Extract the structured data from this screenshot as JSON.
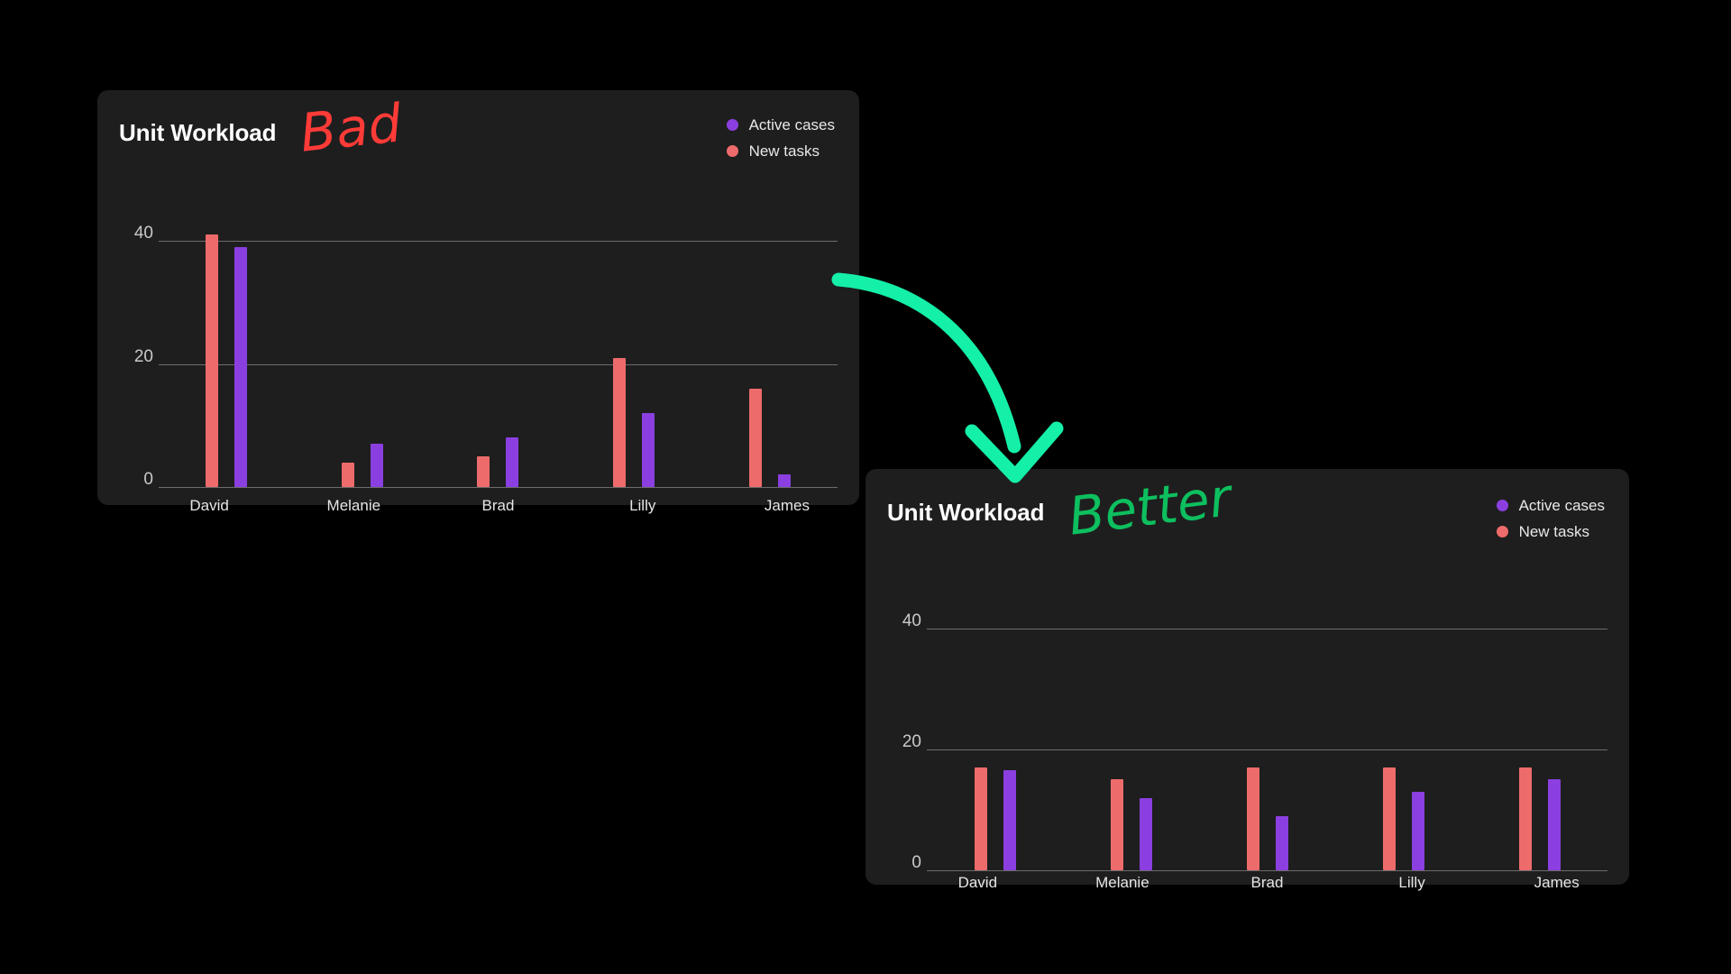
{
  "background_color": "#000000",
  "card_color": "#1e1e1e",
  "colors": {
    "new_tasks": "#ee6b6b",
    "active_cases": "#8b3fe0",
    "gridline": "#6d6d6d",
    "title": "#ffffff",
    "tick_label": "#c9c9c9",
    "annotation_bad": "#ff3b38",
    "annotation_better": "#0dbf5e",
    "arrow": "#14f0a8"
  },
  "annotations": {
    "bad": "Bad",
    "better": "Better",
    "arrow_icon": "curved-arrow-down-right"
  },
  "cards": [
    {
      "id": "bad",
      "title": "Unit Workload",
      "legend": [
        {
          "label": "Active cases",
          "color": "#8b3fe0"
        },
        {
          "label": "New tasks",
          "color": "#ee6b6b"
        }
      ]
    },
    {
      "id": "better",
      "title": "Unit Workload",
      "legend": [
        {
          "label": "Active cases",
          "color": "#8b3fe0"
        },
        {
          "label": "New tasks",
          "color": "#ee6b6b"
        }
      ]
    }
  ],
  "chart_data": [
    {
      "id": "bad",
      "type": "bar",
      "title": "Unit Workload",
      "xlabel": "",
      "ylabel": "",
      "ylim": [
        0,
        44
      ],
      "yticks": [
        0,
        20,
        40
      ],
      "ytick_labels": [
        "0",
        "20",
        "40"
      ],
      "grid": true,
      "legend_position": "top-right",
      "categories": [
        "David",
        "Melanie",
        "Brad",
        "Lilly",
        "James"
      ],
      "series": [
        {
          "name": "New tasks",
          "color": "#ee6b6b",
          "values": [
            41,
            4,
            5,
            21,
            16
          ]
        },
        {
          "name": "Active cases",
          "color": "#8b3fe0",
          "values": [
            39,
            7,
            8,
            12,
            2
          ]
        }
      ]
    },
    {
      "id": "better",
      "type": "bar",
      "title": "Unit Workload",
      "xlabel": "",
      "ylabel": "",
      "ylim": [
        0,
        44
      ],
      "yticks": [
        0,
        20,
        40
      ],
      "ytick_labels": [
        "0",
        "20",
        "40"
      ],
      "grid": true,
      "legend_position": "top-right",
      "categories": [
        "David",
        "Melanie",
        "Brad",
        "Lilly",
        "James"
      ],
      "series": [
        {
          "name": "New tasks",
          "color": "#ee6b6b",
          "values": [
            17,
            15,
            17,
            17,
            17
          ]
        },
        {
          "name": "Active cases",
          "color": "#8b3fe0",
          "values": [
            16.5,
            12,
            9,
            13,
            15
          ]
        }
      ]
    }
  ]
}
